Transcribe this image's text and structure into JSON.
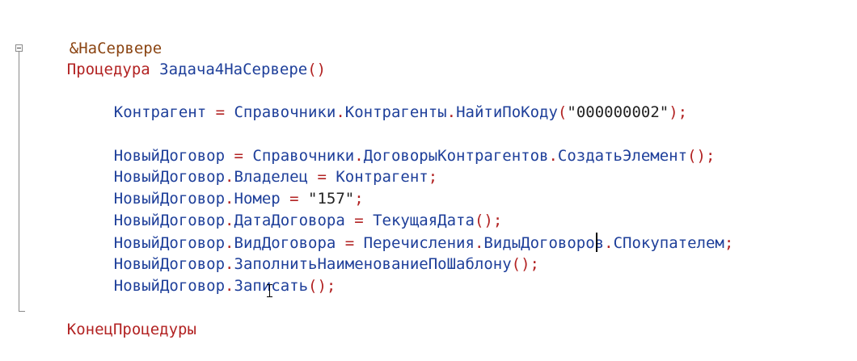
{
  "code": {
    "directive": "&НаСервере",
    "proc_keyword": "Процедура",
    "proc_name": "Задача4НаСервере",
    "parens_open_close": "()",
    "end_keyword": "КонецПроцедуры",
    "line1": {
      "var": "Контрагент",
      "eq": " = ",
      "obj": "Справочники",
      "dot1": ".",
      "coll": "Контрагенты",
      "dot2": ".",
      "method": "НайтиПоКоду",
      "lp": "(",
      "arg": "\"000000002\"",
      "rp_semi": ");"
    },
    "line2": {
      "var": "НовыйДоговор",
      "eq": " = ",
      "obj": "Справочники",
      "dot1": ".",
      "coll": "ДоговорыКонтрагентов",
      "dot2": ".",
      "method": "СоздатьЭлемент",
      "tail": "();"
    },
    "line3": {
      "var": "НовыйДоговор",
      "dot": ".",
      "prop": "Владелец",
      "eq": " = ",
      "val": "Контрагент",
      "semi": ";"
    },
    "line4": {
      "var": "НовыйДоговор",
      "dot": ".",
      "prop": "Номер",
      "eq": " = ",
      "val": "\"157\"",
      "semi": ";"
    },
    "line5": {
      "var": "НовыйДоговор",
      "dot": ".",
      "prop": "ДатаДоговора",
      "eq": " = ",
      "val": "ТекущаяДата",
      "tail": "();"
    },
    "line6": {
      "var": "НовыйДоговор",
      "dot": ".",
      "prop": "ВидДоговора",
      "eq": " = ",
      "obj": "Перечисления",
      "dot1": ".",
      "coll": "ВидыДоговоров",
      "dot2": ".",
      "val": "СПокупателем",
      "semi": ";"
    },
    "line7": {
      "var": "НовыйДоговор",
      "dot": ".",
      "method": "ЗаполнитьНаименованиеПоШаблону",
      "tail": "();"
    },
    "line8": {
      "var": "НовыйДоговор",
      "dot": ".",
      "method": "Записать",
      "tail": "();"
    }
  }
}
